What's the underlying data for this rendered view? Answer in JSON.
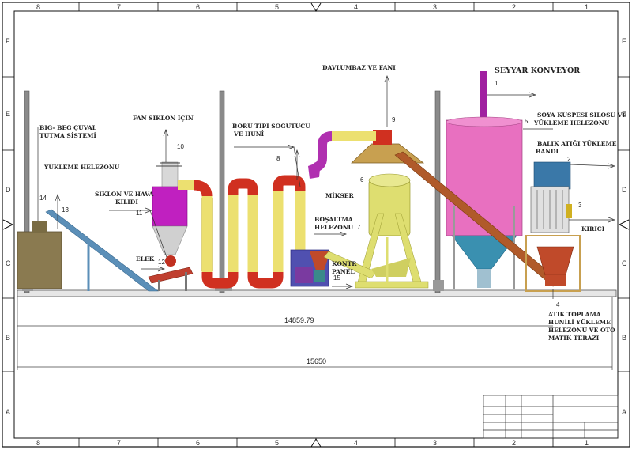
{
  "border": {
    "columns": [
      "8",
      "7",
      "6",
      "5",
      "4",
      "3",
      "2",
      "1"
    ],
    "rows": [
      "F",
      "E",
      "D",
      "C",
      "B",
      "A"
    ]
  },
  "labels": {
    "seyyar_konveyor": "SEYYAR KONVEYOR",
    "davlumbaz": "DAVLUMBAZ VE FANI",
    "soya_line1": "SOYA KÜSPESİ SİLOSU VE",
    "soya_line2": "YÜKLEME HELEZONU",
    "balik_line1": "BALIK ATIĞI YÜKLEME",
    "balik_line2": "BANDI",
    "kirici": "KIRICI",
    "bigbeg_line1": "BIG- BEG ÇUVAL",
    "bigbeg_line2": "TUTMA SİSTEMİ",
    "yukleme_helezonu": "YÜKLEME HELEZONU",
    "fan_siklon": "FAN SIKLON İÇİN",
    "boru_line1": "BORU TİPİ SOĞUTUCU",
    "boru_line2": "VE HUNİ",
    "mikser": "MİKSER",
    "bosaltma_line1": "BOŞALTMA",
    "bosaltma_line2": "HELEZONU",
    "siklon_line1": "SİKLON VE HAVA",
    "siklon_line2": "KİLİDİ",
    "elek": "ELEK",
    "kontr_line1": "KONTR",
    "kontr_line2": "PANEL",
    "atik_line1": "ATIK TOPLAMA",
    "atik_line2": "HUNİLİ YÜKLEME",
    "atik_line3": "HELEZONU VE OTO",
    "atik_line4": "MATİK TERAZİ"
  },
  "numbers": {
    "n1": "1",
    "n2": "2",
    "n3": "3",
    "n4": "4",
    "n5": "5",
    "n6": "6",
    "n7": "7",
    "n8": "8",
    "n9": "9",
    "n10": "10",
    "n11": "11",
    "n12": "12",
    "n13": "13",
    "n14": "14",
    "n15": "15"
  },
  "dimensions": {
    "inner": "14859.79",
    "overall": "15650"
  },
  "colors": {
    "silo": "#e870c0",
    "pipe_yellow": "#ece070",
    "pipe_red": "#d03020",
    "cyclone": "#c020c0",
    "duct_purple": "#b030b0",
    "mixer": "#dede70",
    "conveyor_blue": "#5b8fb8",
    "conveyor_brown": "#b05a2a",
    "kirici_blue": "#3a78a8",
    "atik_red": "#c04a2a",
    "tank_olive": "#8a7a50",
    "panel_blue": "#5050b0",
    "frame_gray": "#888888"
  }
}
